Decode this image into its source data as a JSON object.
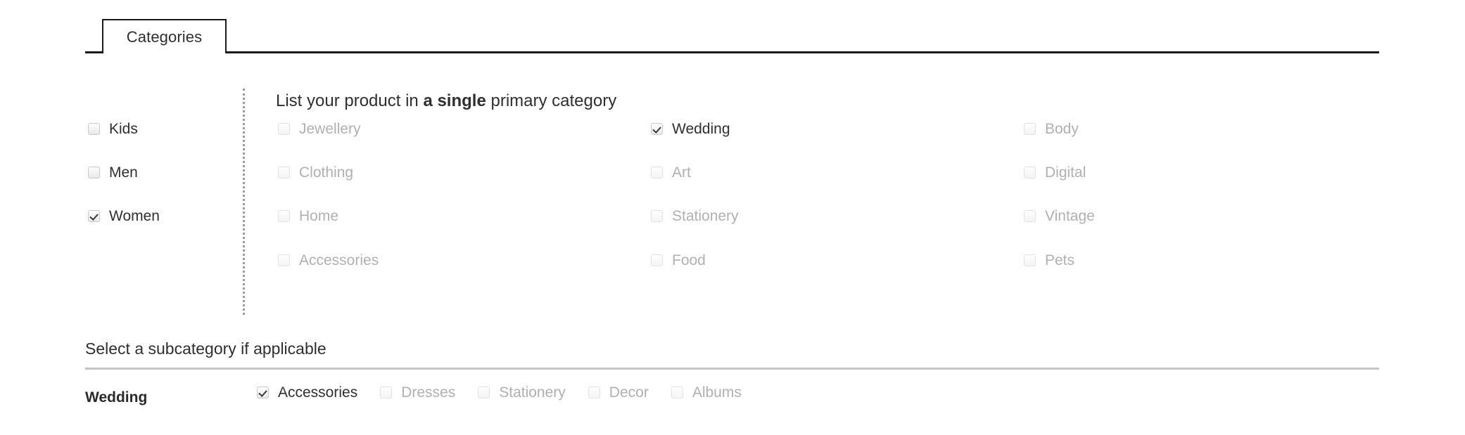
{
  "tabs": [
    {
      "label": "Categories",
      "active": true
    }
  ],
  "primary": {
    "heading_prefix": "List your product in ",
    "heading_emphasis": "a single",
    "heading_suffix": " primary category",
    "audience": {
      "items": [
        {
          "label": "Kids",
          "checked": false,
          "disabled": false
        },
        {
          "label": "Men",
          "checked": false,
          "disabled": false
        },
        {
          "label": "Women",
          "checked": true,
          "disabled": false
        }
      ]
    },
    "columns": [
      {
        "items": [
          {
            "label": "Jewellery",
            "checked": false,
            "disabled": true
          },
          {
            "label": "Clothing",
            "checked": false,
            "disabled": true
          },
          {
            "label": "Home",
            "checked": false,
            "disabled": true
          },
          {
            "label": "Accessories",
            "checked": false,
            "disabled": true
          }
        ]
      },
      {
        "items": [
          {
            "label": "Wedding",
            "checked": true,
            "disabled": false
          },
          {
            "label": "Art",
            "checked": false,
            "disabled": true
          },
          {
            "label": "Stationery",
            "checked": false,
            "disabled": true
          },
          {
            "label": "Food",
            "checked": false,
            "disabled": true
          }
        ]
      },
      {
        "items": [
          {
            "label": "Body",
            "checked": false,
            "disabled": true
          },
          {
            "label": "Digital",
            "checked": false,
            "disabled": true
          },
          {
            "label": "Vintage",
            "checked": false,
            "disabled": true
          },
          {
            "label": "Pets",
            "checked": false,
            "disabled": true
          }
        ]
      }
    ]
  },
  "subcategory": {
    "title": "Select a subcategory if applicable",
    "group_label": "Wedding",
    "items": [
      {
        "label": "Accessories",
        "checked": true,
        "disabled": false
      },
      {
        "label": "Dresses",
        "checked": false,
        "disabled": true
      },
      {
        "label": "Stationery",
        "checked": false,
        "disabled": true
      },
      {
        "label": "Decor",
        "checked": false,
        "disabled": true
      },
      {
        "label": "Albums",
        "checked": false,
        "disabled": true
      }
    ]
  },
  "colors": {
    "tab_border": "#1a1a1a",
    "text": "#2f2f2f",
    "disabled_text": "#b0b0b0",
    "divider": "#c4c4c4",
    "dotted_divider": "#9b9b9b"
  }
}
